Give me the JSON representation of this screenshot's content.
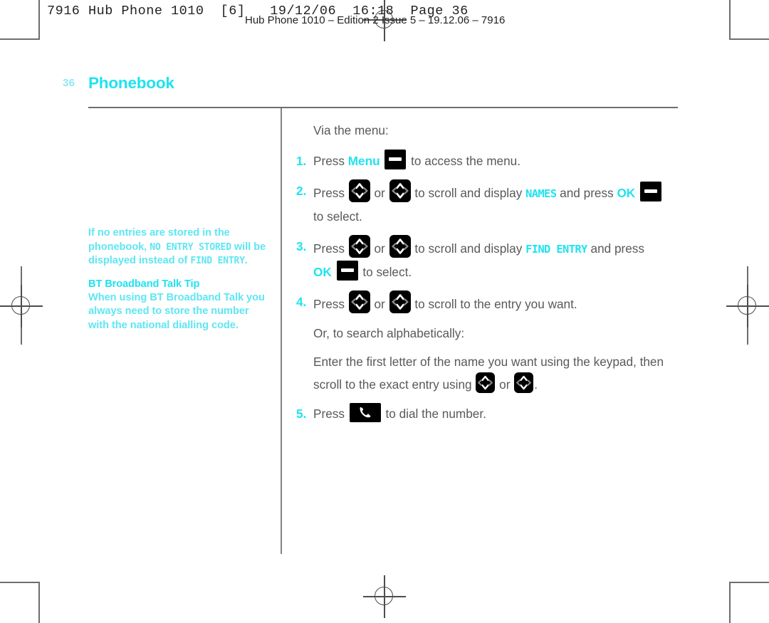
{
  "print_strip": {
    "line1": "7916 Hub Phone 1010  [6]   19/12/06  16:18  Page 36",
    "line2": "Hub Phone 1010 – Edition 2 Issue 5 – 19.12.06 – 7916"
  },
  "header": {
    "page_number": "36",
    "title": "Phonebook"
  },
  "sidebar": {
    "note": {
      "part1": "If no entries are stored in the phonebook, ",
      "lcd1": "NO ENTRY STORED",
      "part2": " will be displayed instead of ",
      "lcd2": "FIND ENTRY",
      "part3": "."
    },
    "tip": {
      "title": "BT Broadband Talk Tip",
      "body": "When using BT Broadband Talk you always need to store the number with the national dialling code."
    }
  },
  "main": {
    "lead": "Via the menu:",
    "steps": [
      {
        "num": "1.",
        "t1": "Press ",
        "kw1": "Menu",
        "t2": " to access the menu.",
        "icons": [
          "ok-key"
        ]
      },
      {
        "num": "2.",
        "t1": "Press ",
        "t2": " or ",
        "t3": " to scroll and display ",
        "lcd": "NAMES",
        "t4": " and press ",
        "kw1": "OK",
        "t5": "to select.",
        "icons": [
          "nav-key",
          "nav-key",
          "ok-key"
        ]
      },
      {
        "num": "3.",
        "t1": "Press ",
        "t2": " or ",
        "t3": " to scroll and display ",
        "lcd": "FIND ENTRY",
        "t4": " and press ",
        "kw1": "OK",
        "t5": " to select.",
        "icons": [
          "nav-key",
          "nav-key",
          "ok-key"
        ]
      },
      {
        "num": "4.",
        "t1": "Press ",
        "t2": " or ",
        "t3": " to scroll to the entry you want.",
        "icons": [
          "nav-key",
          "nav-key"
        ]
      },
      {
        "num": "5.",
        "t1": "Press ",
        "t2": " to dial the number.",
        "icons": [
          "call-key"
        ]
      }
    ],
    "alt_lead": "Or, to search alphabetically:",
    "alt_body": {
      "t1": "Enter the first letter of the name you want using the keypad, then scroll to the exact entry using ",
      "t2": " or ",
      "t3": "."
    }
  },
  "colors": {
    "cyan": "#1ee3f0",
    "cyan_light": "#5fe6f2",
    "body_gray": "#58595b",
    "rule_gray": "#6d6e70",
    "key_black": "#000000"
  },
  "icons": {
    "nav_key": "navigation-4way-key-icon",
    "ok_key": "ok-menu-key-icon",
    "call_key": "call-handset-key-icon"
  }
}
